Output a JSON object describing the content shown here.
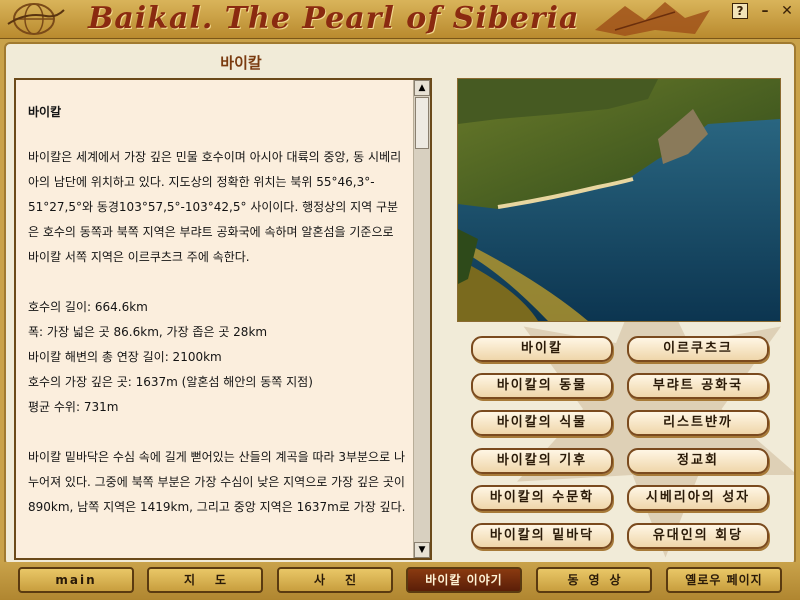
{
  "window": {
    "title": "Baikal. The Pearl of Siberia",
    "help_label": "?",
    "minimize_label": "–",
    "close_label": "✕"
  },
  "section_title": "바이칼",
  "article": {
    "heading": "바이칼",
    "p1": "바이칼은 세계에서 가장 깊은 민물 호수이며 아시아 대륙의 중앙, 동 시베리아의 남단에 위치하고 있다. 지도상의 정확한 위치는 북위 55°46,3°- 51°27,5°와 동경103°57,5°-103°42,5° 사이이다. 행정상의 지역 구분은 호수의 동쪽과 북쪽 지역은 부랴트 공화국에 속하며 알혼섬을 기준으로 바이칼 서쪽 지역은 이르쿠츠크 주에 속한다.",
    "facts": [
      "호수의 길이: 664.6km",
      "폭: 가장 넓은 곳 86.6km, 가장 좁은 곳 28km",
      "바이칼 해변의 총 연장 길이: 2100km",
      "호수의 가장 깊은 곳: 1637m (알혼섬 해안의 동쪽 지점)",
      "평균 수위: 731m"
    ],
    "p2": "바이칼 밑바닥은 수심 속에 길게 뻗어있는 산들의 계곡을 따라 3부분으로 나누어져 있다. 그중에 북쪽 부분은 가장 수심이 낮은 지역으로 가장 깊은 곳이 890km, 남쪽 지역은 1419km, 그리고 중앙 지역은 1637m로 가장 깊다."
  },
  "nav_buttons": [
    "바이칼",
    "이르쿠츠크",
    "바이칼의 동물",
    "부랴트 공화국",
    "바이칼의 식물",
    "리스트뱐까",
    "바이칼의 기후",
    "정교회",
    "바이칼의 수문학",
    "시베리아의 성자",
    "바이칼의 밑바닥",
    "유대인의 회당"
  ],
  "tabs": [
    "main",
    "지도",
    "사진",
    "바이칼 이야기",
    "동영상",
    "옐로우 페이지"
  ],
  "active_tab": "바이칼 이야기",
  "colors": {
    "frame": "#c9a24a",
    "title_text": "#8a2a10",
    "panel": "#fbeedd",
    "active_tab": "#6a2a0c"
  }
}
